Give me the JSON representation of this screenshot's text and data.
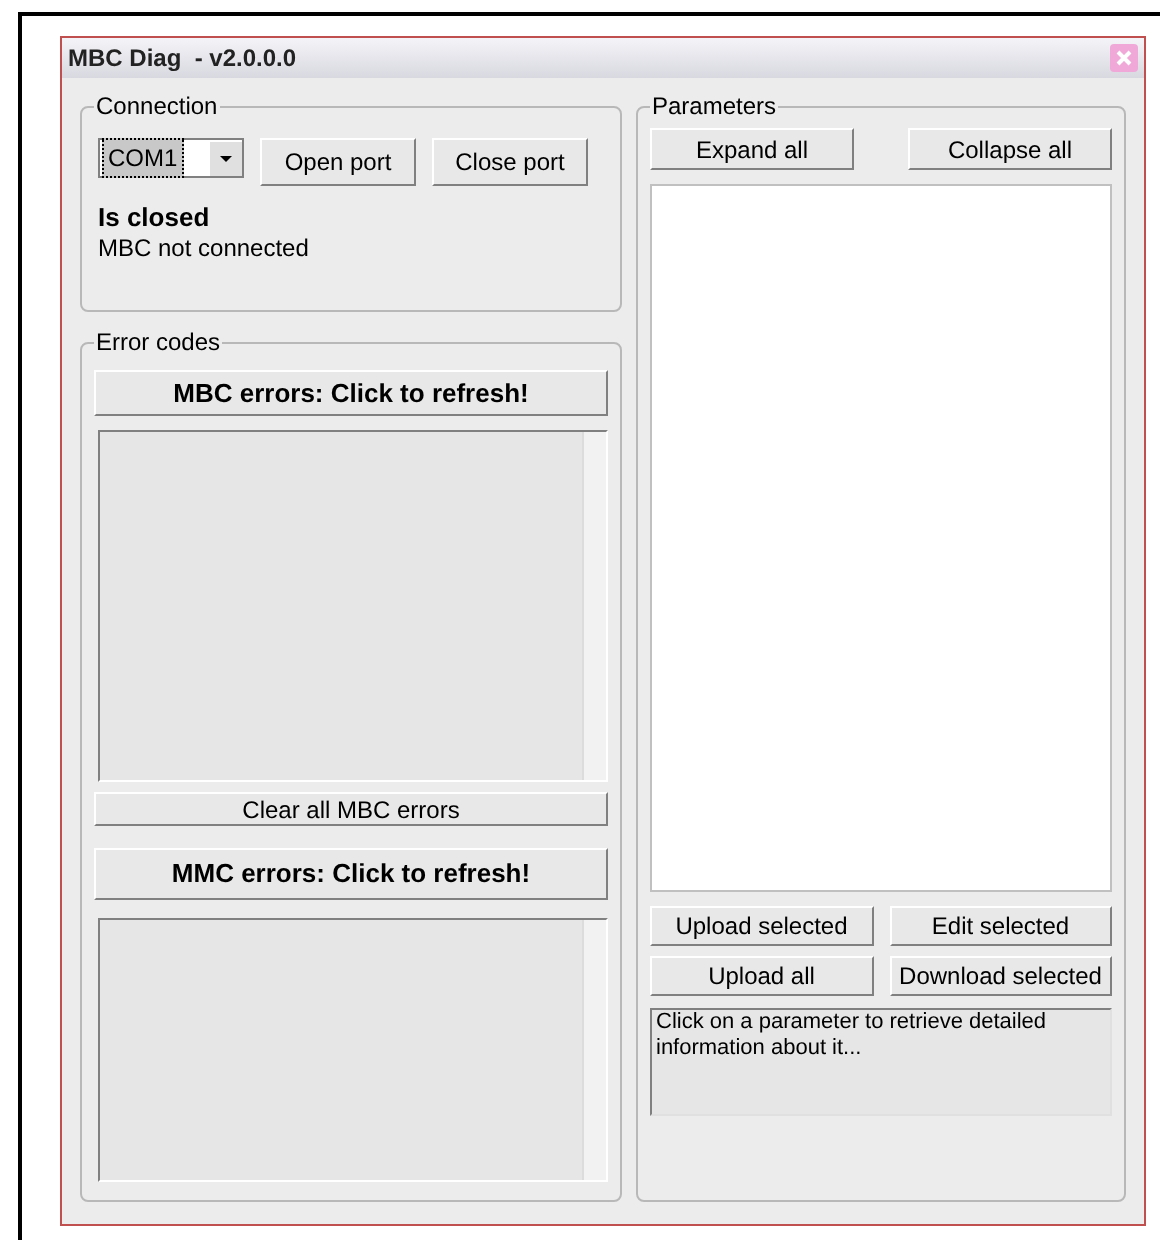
{
  "window": {
    "title": "MBC Diag  - v2.0.0.0"
  },
  "connection": {
    "title": "Connection",
    "port": {
      "value": "COM1"
    },
    "buttons": [
      "Open port",
      "Close port"
    ],
    "status": "Is closed",
    "message": "MBC not connected"
  },
  "error_codes": {
    "title": "Error codes",
    "mbc_button": "MBC errors: Click to refresh!",
    "clear_button": "Clear all MBC errors",
    "mmc_button": "MMC errors: Click to refresh!"
  },
  "parameters": {
    "title": "Parameters",
    "tree_buttons": [
      "Expand all",
      "Collapse all"
    ],
    "action_buttons": [
      "Upload selected",
      "Edit selected",
      "Upload all",
      "Download selected"
    ],
    "info": "Click on a parameter to retrieve detailed information about it..."
  }
}
